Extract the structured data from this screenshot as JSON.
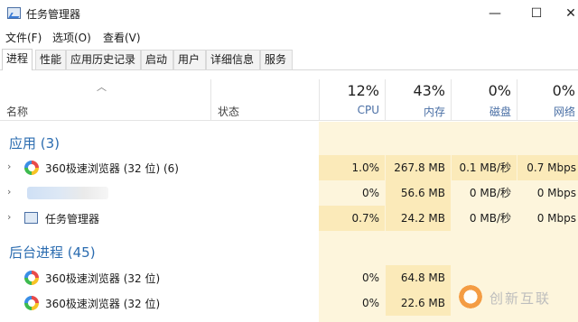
{
  "window": {
    "title": "任务管理器",
    "controls": {
      "minimize": "—",
      "maximize": "☐",
      "close": "✕"
    }
  },
  "menu": [
    "文件(F)",
    "选项(O)",
    "查看(V)"
  ],
  "tabs": [
    "进程",
    "性能",
    "应用历史记录",
    "启动",
    "用户",
    "详细信息",
    "服务"
  ],
  "active_tab": 0,
  "columns": {
    "name": "名称",
    "status": "状态",
    "metrics": [
      {
        "pct": "12%",
        "label": "CPU"
      },
      {
        "pct": "43%",
        "label": "内存"
      },
      {
        "pct": "0%",
        "label": "磁盘"
      },
      {
        "pct": "0%",
        "label": "网络"
      }
    ]
  },
  "sections": {
    "apps": {
      "title": "应用 (3)"
    },
    "background": {
      "title": "后台进程 (45)"
    }
  },
  "rows": [
    {
      "name": "360极速浏览器 (32 位) (6)",
      "icon": "browser-360-icon",
      "values": [
        "1.0%",
        "267.8 MB",
        "0.1 MB/秒",
        "0.7 Mbps"
      ]
    },
    {
      "name": "",
      "icon": "blurred-app",
      "values": [
        "0%",
        "56.6 MB",
        "0 MB/秒",
        "0 Mbps"
      ]
    },
    {
      "name": "任务管理器",
      "icon": "task-manager-icon",
      "values": [
        "0.7%",
        "24.2 MB",
        "0 MB/秒",
        "0 Mbps"
      ]
    },
    {
      "name": "360极速浏览器 (32 位)",
      "icon": "browser-360-icon",
      "values": [
        "0%",
        "64.8 MB",
        "",
        ""
      ]
    },
    {
      "name": "360极速浏览器 (32 位)",
      "icon": "browser-360-icon",
      "values": [
        "0%",
        "22.6 MB",
        "",
        ""
      ]
    }
  ],
  "watermark": {
    "text": "创新互联"
  },
  "colors": {
    "heat_strong": "#fbeab9",
    "heat_light": "#fdf5dc",
    "section_blue": "#2b6cb0",
    "metric_label": "#4a6fa5"
  }
}
